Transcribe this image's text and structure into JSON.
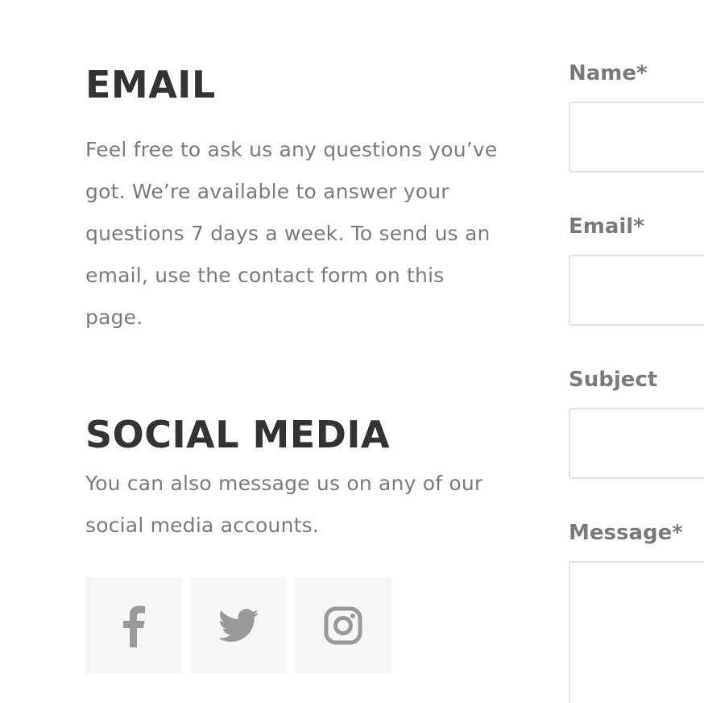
{
  "email_section": {
    "heading": "EMAIL",
    "text": "Feel free to ask us any questions you’ve got. We’re available to answer your questions 7 days a week. To send us an email, use the contact form on this page."
  },
  "social_section": {
    "heading": "SOCIAL MEDIA",
    "text": "You can also message us on any of our social media accounts.",
    "buttons": [
      {
        "icon": "facebook-icon"
      },
      {
        "icon": "twitter-icon"
      },
      {
        "icon": "instagram-icon"
      }
    ]
  },
  "form": {
    "name_label": "Name*",
    "email_label": "Email*",
    "subject_label": "Subject",
    "message_label": "Message*"
  },
  "colors": {
    "heading": "#333333",
    "text": "#7a7a7a",
    "icon": "#999999",
    "social_bg": "#f6f6f6",
    "input_border": "#e2e2e2"
  }
}
